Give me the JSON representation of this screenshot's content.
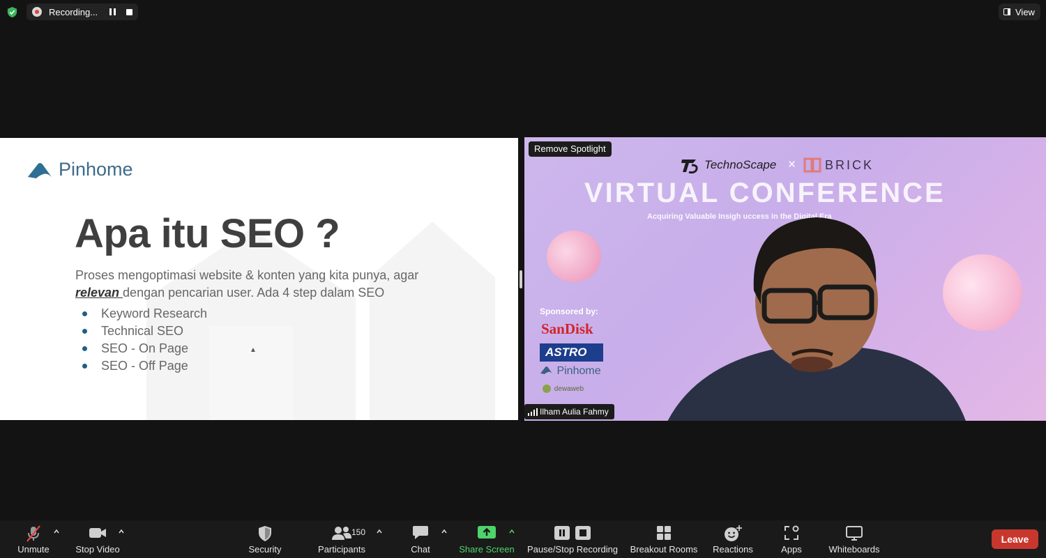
{
  "topbar": {
    "recording_label": "Recording...",
    "view_label": "View"
  },
  "slide": {
    "logo_text": "Pinhome",
    "title": "Apa itu SEO ?",
    "body_before": "Proses mengoptimasi website & konten yang kita punya, agar",
    "body_emph": "relevan ",
    "body_after": "dengan pencarian user. Ada 4 step dalam SEO",
    "bullets": [
      "Keyword Research",
      "Technical SEO",
      "SEO - On Page",
      "SEO - Off Page"
    ]
  },
  "video": {
    "spotlight_label": "Remove Spotlight",
    "participant_name": "Ilham Aulia Fahmy",
    "brand_left": "TechnoScape",
    "brand_sep": "×",
    "brand_right": "BRICK",
    "banner_title": "VIRTUAL CONFERENCE",
    "banner_subtitle": "Acquiring Valuable Insigh       uccess in the Digital Era",
    "sponsored_label": "Sponsored by:",
    "sponsor_1": "SanDisk",
    "sponsor_2": "ASTRO",
    "sponsor_3": "Pinhome",
    "sponsor_4": "dewaweb"
  },
  "toolbar": {
    "unmute": "Unmute",
    "stop_video": "Stop Video",
    "security": "Security",
    "participants": "Participants",
    "participants_count": "150",
    "chat": "Chat",
    "share_screen": "Share Screen",
    "pause_stop_recording": "Pause/Stop Recording",
    "breakout_rooms": "Breakout Rooms",
    "reactions": "Reactions",
    "apps": "Apps",
    "whiteboards": "Whiteboards",
    "leave": "Leave"
  },
  "colors": {
    "background": "#131313",
    "toolbar": "#1a1a1a",
    "leave": "#c8372e",
    "share_green": "#4fd36b",
    "slide_bullet": "#1f5f83"
  }
}
